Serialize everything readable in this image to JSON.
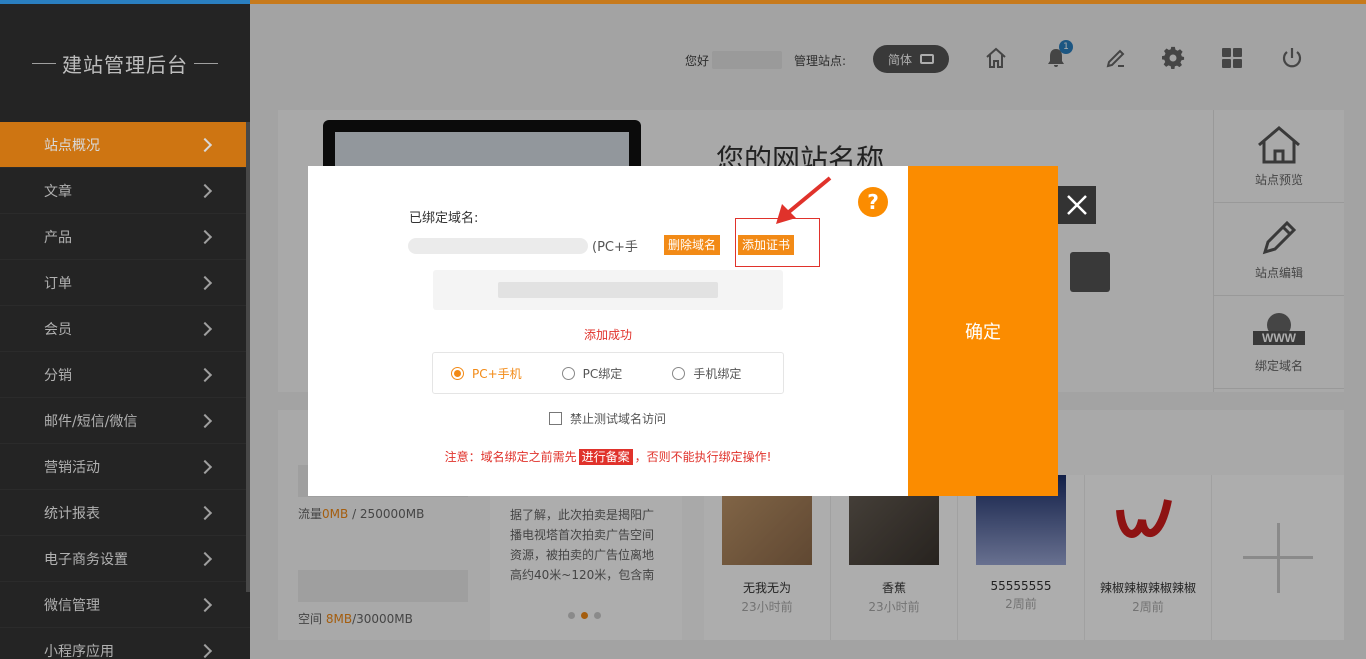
{
  "app": {
    "brand": "建站管理后台"
  },
  "sidebar": {
    "items": [
      {
        "label": "站点概况"
      },
      {
        "label": "文章"
      },
      {
        "label": "产品"
      },
      {
        "label": "订单"
      },
      {
        "label": "会员"
      },
      {
        "label": "分销"
      },
      {
        "label": "邮件/短信/微信"
      },
      {
        "label": "营销活动"
      },
      {
        "label": "统计报表"
      },
      {
        "label": "电子商务设置"
      },
      {
        "label": "微信管理"
      },
      {
        "label": "小程序应用"
      }
    ]
  },
  "header": {
    "greeting": "您好",
    "site_label": "管理站点:",
    "lang": "简体",
    "notification_count": "1",
    "icons": [
      "home-icon",
      "bell-icon",
      "edit-icon",
      "gear-icon",
      "grid-icon",
      "power-icon"
    ]
  },
  "site": {
    "name": "您的网站名称",
    "actions": [
      {
        "label": "站点预览",
        "icon": "house-icon"
      },
      {
        "label": "站点编辑",
        "icon": "pencil-icon"
      },
      {
        "label": "绑定域名",
        "icon": "www-icon"
      }
    ]
  },
  "stats": {
    "traffic_prefix": "流量",
    "traffic_used": "0MB",
    "traffic_total": " / 250000MB",
    "space_prefix": "空间 ",
    "space_used": "8MB",
    "space_total": "/30000MB"
  },
  "news": {
    "text": "据了解，此次拍卖是揭阳广播电视塔首次拍卖广告空间资源，被拍卖的广告位离地高约40米~120米，包含南"
  },
  "products": [
    {
      "name": "无我无为",
      "time": "23小时前"
    },
    {
      "name": "香蕉",
      "time": "23小时前"
    },
    {
      "name": "55555555",
      "time": "2周前"
    },
    {
      "name": "辣椒辣椒辣椒辣椒",
      "time": "2周前"
    }
  ],
  "modal": {
    "bound_label": "已绑定域名:",
    "domain_type": "(PC+手",
    "delete_btn": "删除域名",
    "add_cert_btn": "添加证书",
    "success_msg": "添加成功",
    "radios": [
      {
        "label": "PC+手机",
        "selected": true
      },
      {
        "label": "PC绑定",
        "selected": false
      },
      {
        "label": "手机绑定",
        "selected": false
      }
    ],
    "forbid_label": "禁止测试域名访问",
    "notice_pre": "注意：域名绑定之前需先",
    "notice_btn": "进行备案",
    "notice_post": "，否则不能执行绑定操作!",
    "confirm": "确定",
    "help": "?"
  },
  "colors": {
    "accent": "#f28a16",
    "confirm": "#fb8c00",
    "alert": "#e0322b",
    "sidebar": "#2b2b2b"
  }
}
